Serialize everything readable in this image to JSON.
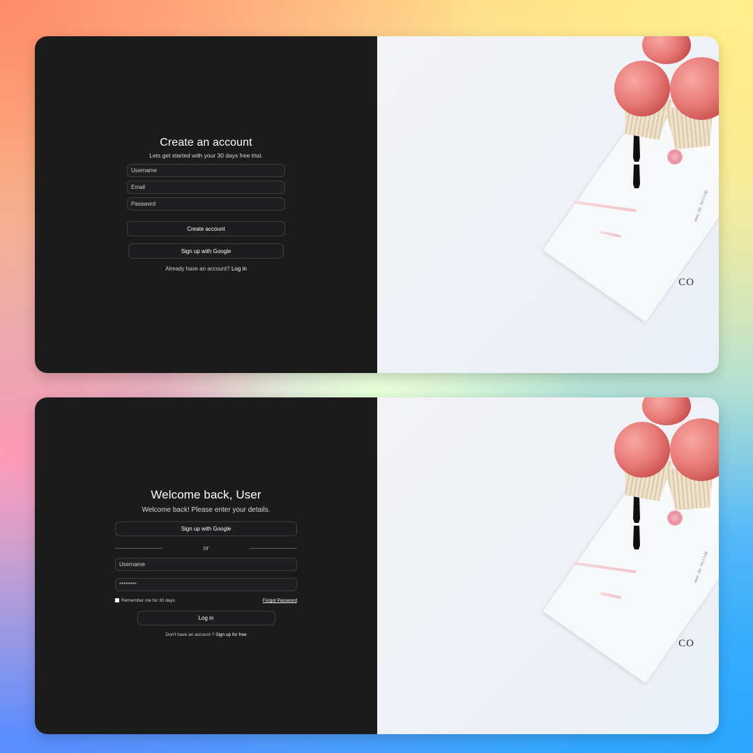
{
  "signup": {
    "title": "Create an account",
    "subtitle": "Lets get started with your 30 days free trial.",
    "username_placeholder": "Username",
    "email_placeholder": "Email",
    "password_placeholder": "Password",
    "create_button": "Create account",
    "google_button": "Sign up with Google",
    "footer_text": "Already have an account?",
    "footer_link": "Log in"
  },
  "login": {
    "title": "Welcome back, User",
    "subtitle": "Welcome back! Please enter your details.",
    "google_button": "Sign up with Google",
    "divider_text": "or",
    "username_placeholder": "Username",
    "password_value": "********",
    "remember_label": "Remember me for 30 days",
    "forgot_link": "Forgot Password",
    "login_button": "Log in",
    "footer_text": "Don't have an account ?",
    "footer_link": "Sign up for free"
  },
  "decor": {
    "brand": "CO",
    "note_text": "www.de hello@"
  },
  "colors": {
    "panel": "#1b1b1c",
    "field_border": "#3e3e40",
    "text": "#ffffff"
  }
}
